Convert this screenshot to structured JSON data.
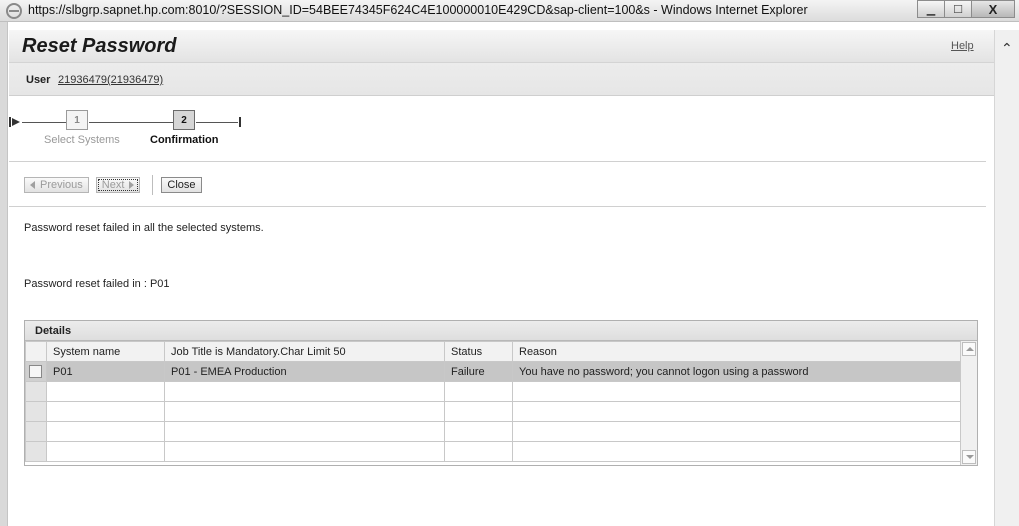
{
  "window": {
    "title": "https://slbgrp.sapnet.hp.com:8010/?SESSION_ID=54BEE74345F624C4E100000010E429CD&sap-client=100&s - Windows Internet Explorer",
    "minimize_glyph": "▁",
    "maximize_glyph": "☐",
    "close_glyph": "X"
  },
  "header": {
    "title": "Reset Password",
    "help_label": "Help",
    "user_label": "User",
    "user_value": "21936479(21936479)"
  },
  "roadmap": {
    "steps": [
      {
        "number": "1",
        "label": "Select Systems",
        "state": "inactive"
      },
      {
        "number": "2",
        "label": "Confirmation",
        "state": "active"
      }
    ]
  },
  "toolbar": {
    "previous_label": "Previous",
    "next_label": "Next",
    "close_label": "Close"
  },
  "messages": {
    "summary": "Password reset failed in all the selected systems.",
    "failed_in": "Password reset failed in : P01"
  },
  "details": {
    "title": "Details",
    "columns": [
      "System name",
      "Job Title is Mandatory.Char Limit 50",
      "Status",
      "Reason"
    ],
    "rows": [
      [
        "P01",
        "P01 - EMEA Production",
        "Failure",
        "You have no password; you cannot logon using a password"
      ]
    ]
  },
  "icons": {
    "browser": "ie-icon",
    "scroll_up": "chevron-up-icon",
    "roadmap_start": "roadmap-start-icon",
    "roadmap_end": "roadmap-end-icon"
  }
}
